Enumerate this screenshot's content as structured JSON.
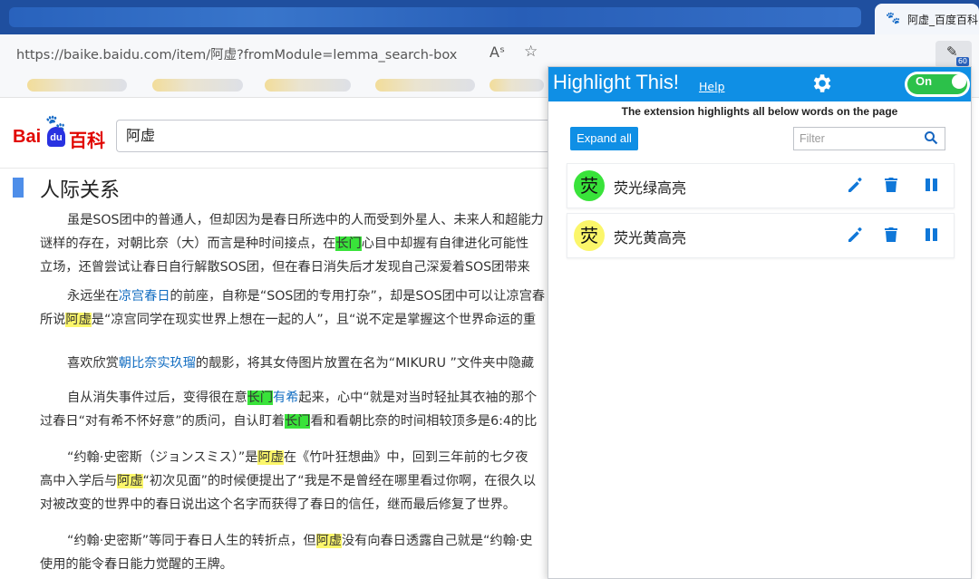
{
  "browser": {
    "tab_title": "阿虚_百度百科",
    "url": "https://baike.baidu.com/item/阿虚?fromModule=lemma_search-box",
    "extension_badge": "60"
  },
  "baike": {
    "logo_bai": "Bai",
    "logo_du": "du",
    "logo_baike": "百科",
    "search_value": "阿虚",
    "section_title": "人际关系",
    "paragraphs": [
      {
        "lines": [
          [
            {
              "t": "虽是SOS团中的普通人，但却因为是春日所选中的人而受到外星人、未来人和超能力"
            }
          ],
          [
            {
              "t": "谜样的存在，对朝比奈（大）而言是种时间接点，在"
            },
            {
              "t": "长门",
              "c": "hl-g"
            },
            {
              "t": "心目中却握有自律进化可能性"
            }
          ],
          [
            {
              "t": "立场，还曾尝试让春日自行解散SOS团，但在春日消失后才发现自己深爱着SOS团带来"
            }
          ]
        ]
      },
      {
        "lines": [
          [
            {
              "t": "永远坐在"
            },
            {
              "t": "凉宫春日",
              "c": "lnk"
            },
            {
              "t": "的前座，自称是“SOS团的专用打杂”，却是SOS团中可以让凉宫春"
            }
          ],
          [
            {
              "t": "所说"
            },
            {
              "t": "阿虚",
              "c": "hl-y"
            },
            {
              "t": "是“凉宫同学在现实世界上想在一起的人”，且“说不定是掌握这个世界命运的重"
            }
          ]
        ]
      },
      {
        "lines": [
          [
            {
              "t": "喜欢欣赏"
            },
            {
              "t": "朝比奈实玖瑠",
              "c": "lnk"
            },
            {
              "t": "的靓影，将其女侍图片放置在名为“MIKURU ”文件夹中隐藏"
            }
          ]
        ]
      },
      {
        "lines": [
          [
            {
              "t": "自从消失事件过后，变得很在意"
            },
            {
              "t": "长门",
              "c": "hl-g"
            },
            {
              "t": "有希",
              "c": "lnk"
            },
            {
              "t": "起来，心中“就是对当时轻扯其衣袖的那个"
            }
          ],
          [
            {
              "t": "过春日“对有希不怀好意”的质问，自认盯着"
            },
            {
              "t": "长门",
              "c": "hl-g"
            },
            {
              "t": "看和看朝比奈的时间相较顶多是6:4的比"
            }
          ]
        ]
      },
      {
        "lines": [
          [
            {
              "t": "“约翰·史密斯（ジョンスミス）”是"
            },
            {
              "t": "阿虚",
              "c": "hl-y"
            },
            {
              "t": "在《竹叶狂想曲》中，回到三年前的七夕夜"
            }
          ],
          [
            {
              "t": "高中入学后与"
            },
            {
              "t": "阿虚",
              "c": "hl-y"
            },
            {
              "t": "“初次见面”的时候便提出了“我是不是曾经在哪里看过你啊，在很久以"
            }
          ],
          [
            {
              "t": "对被改变的世界中的春日说出这个名字而获得了春日的信任，继而最后修复了世界。"
            }
          ]
        ]
      },
      {
        "lines": [
          [
            {
              "t": "“约翰·史密斯”等同于春日人生的转折点，但"
            },
            {
              "t": "阿虚",
              "c": "hl-y"
            },
            {
              "t": "没有向春日透露自己就是“约翰·史"
            }
          ],
          [
            {
              "t": "使用的能令春日能力觉醒的王牌。"
            }
          ]
        ]
      }
    ]
  },
  "extension": {
    "title": "Highlight This!",
    "help": "Help",
    "toggle": "On",
    "description": "The extension highlights all below words on the page",
    "expand_all": "Expand all",
    "filter_placeholder": "Filter",
    "colors": {
      "header": "#0f8fe5",
      "toggle": "#2cc14a",
      "green": "#39e33a",
      "yellow": "#fbf66a",
      "action": "#0f77d8"
    },
    "items": [
      {
        "sample": "荧",
        "name": "荧光绿高亮",
        "color": "#39e33a"
      },
      {
        "sample": "荧",
        "name": "荧光黄高亮",
        "color": "#fbf66a"
      }
    ]
  }
}
